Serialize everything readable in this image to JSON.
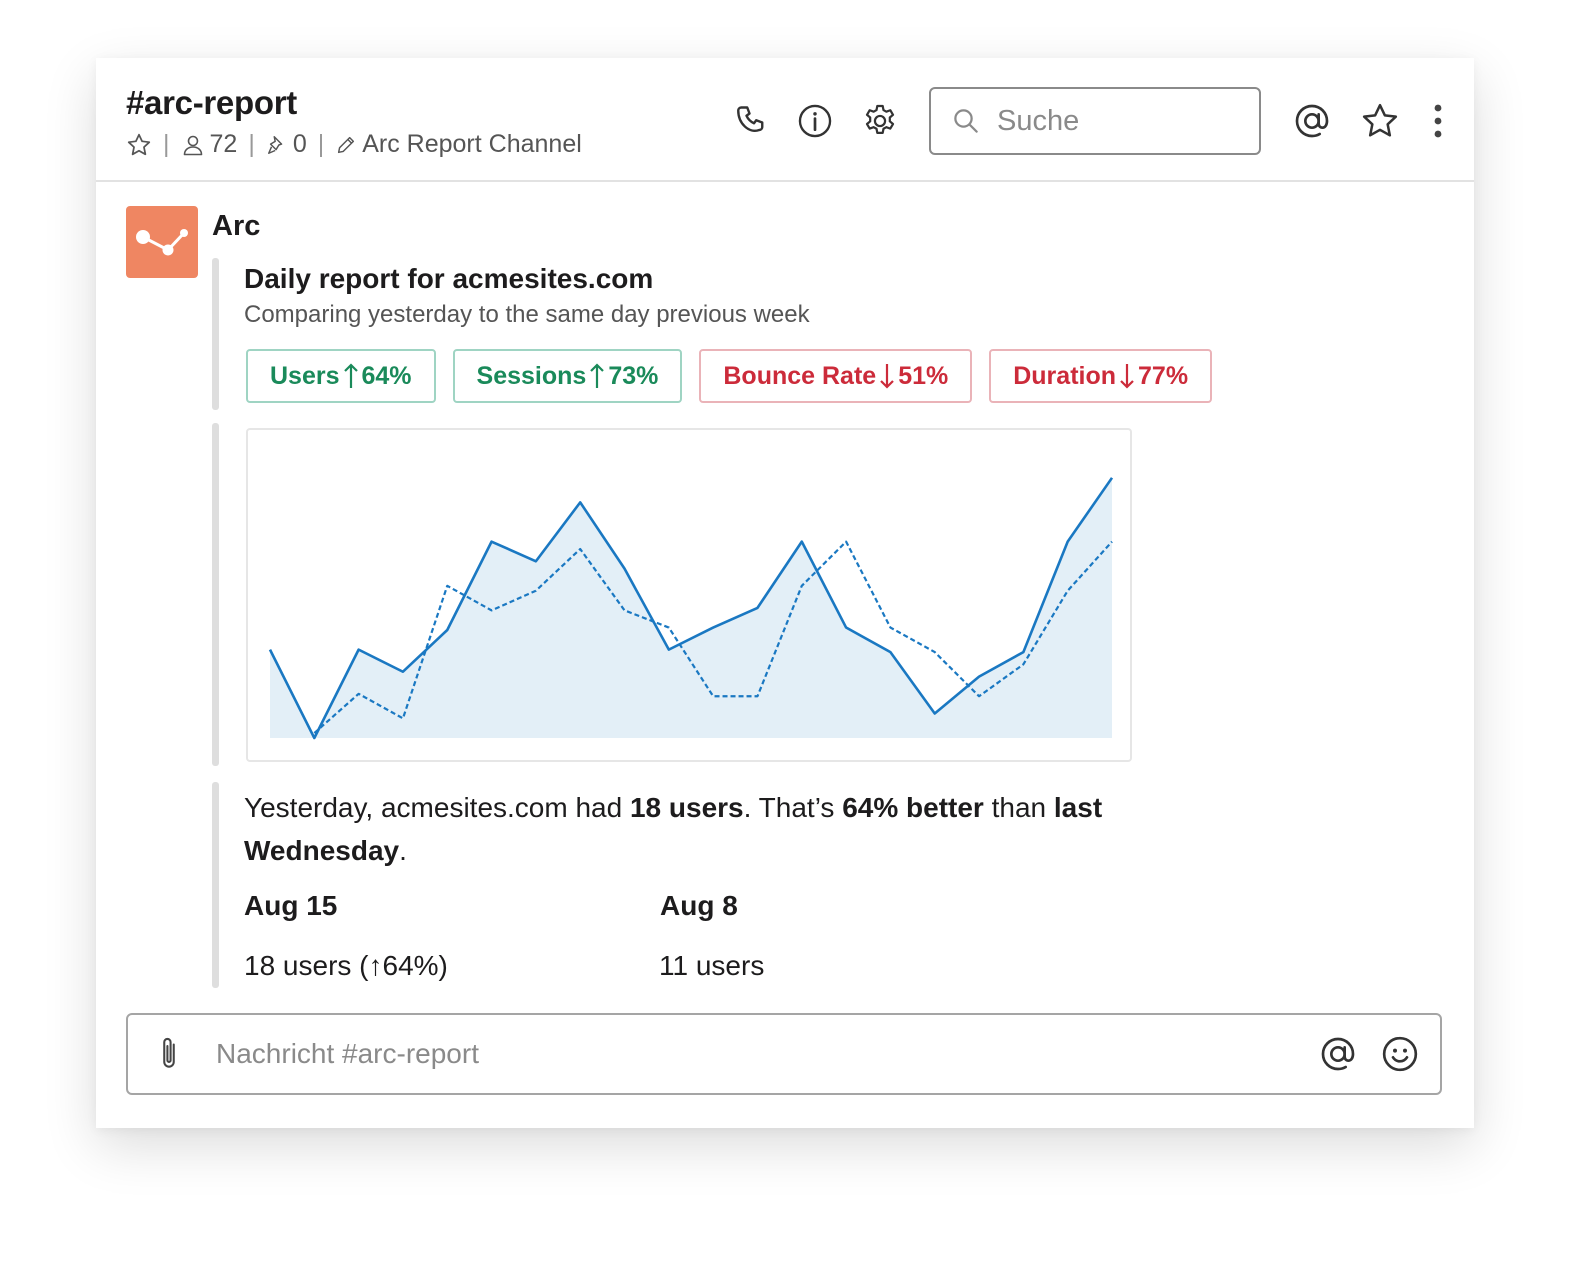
{
  "channel": {
    "name": "#arc-report",
    "members": "72",
    "pins": "0",
    "topic": "Arc Report Channel"
  },
  "search": {
    "placeholder": "Suche"
  },
  "message": {
    "sender": "Arc",
    "attachment_title": "Daily report for acmesites.com",
    "attachment_subtitle": "Comparing yesterday to the same day previous week",
    "pills": [
      {
        "label": "Users",
        "value": "64%",
        "direction": "up",
        "color": "#1a8a5a"
      },
      {
        "label": "Sessions",
        "value": "73%",
        "direction": "up",
        "color": "#1a8a5a"
      },
      {
        "label": "Bounce Rate",
        "value": "51%",
        "direction": "down",
        "color": "#cc2b3a"
      },
      {
        "label": "Duration",
        "value": "77%",
        "direction": "down",
        "color": "#cc2b3a"
      }
    ],
    "summary": {
      "t1": "Yesterday, acmesites.com had ",
      "b1": "18 users",
      "t2": ". That’s ",
      "b2": "64% better",
      "t3": " than ",
      "b3": "last Wednesday",
      "t4": "."
    },
    "stats": [
      {
        "heading": "Aug 15",
        "value": "18 users (↑64%)"
      },
      {
        "heading": "Aug 8",
        "value": "11 users"
      }
    ]
  },
  "composer": {
    "placeholder": "Nachricht #arc-report"
  },
  "icons": [
    "star-icon",
    "user-icon",
    "pin-icon",
    "pencil-icon",
    "phone-icon",
    "info-icon",
    "gear-icon",
    "search-icon",
    "at-icon",
    "star-icon",
    "more-vertical-icon",
    "paperclip-icon",
    "at-icon",
    "emoji-icon"
  ],
  "colors": {
    "avatar": "#ef8662",
    "chart_line": "#1a78c2",
    "chart_fill": "#e3eff7",
    "up": "#1a8a5a",
    "down": "#cc2b3a"
  },
  "chart_data": {
    "type": "line",
    "x": [
      1,
      2,
      3,
      4,
      5,
      6,
      7,
      8,
      9,
      10,
      11,
      12,
      13,
      14,
      15,
      16,
      17,
      18,
      19,
      20
    ],
    "series": [
      {
        "values": [
          36,
          0,
          36,
          27,
          44,
          80,
          72,
          96,
          69,
          36,
          45,
          53,
          80,
          45,
          35,
          10,
          25,
          35,
          80,
          106
        ],
        "style": "solid",
        "area": true
      },
      {
        "values": [
          null,
          2,
          18,
          8,
          62,
          52,
          60,
          77,
          52,
          45,
          17,
          17,
          62,
          80,
          45,
          35,
          17,
          30,
          60,
          80
        ],
        "style": "dashed",
        "area": false
      }
    ],
    "ylim": [
      0,
      110
    ],
    "grid": false,
    "legend": "none"
  }
}
